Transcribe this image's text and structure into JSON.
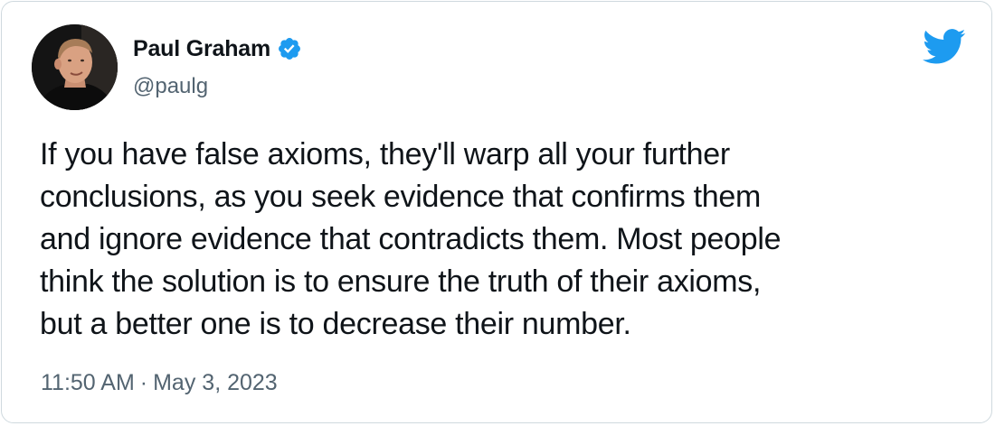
{
  "tweet": {
    "author_name": "Paul Graham",
    "author_handle": "@paulg",
    "text": "If you have false axioms, they'll warp all your further\nconclusions, as you seek evidence that confirms them\nand ignore evidence that contradicts them. Most people\nthink the solution is to ensure the truth of their axioms,\nbut a better one is to decrease their number.",
    "time": "11:50 AM",
    "separator": "·",
    "date": "May 3, 2023"
  },
  "icons": {
    "verified": "verified-badge-icon",
    "platform": "twitter-bird-icon",
    "avatar": "profile-photo"
  },
  "colors": {
    "accent": "#1d9bf0",
    "text": "#0f1419",
    "secondary": "#536471",
    "border": "#cfd9de"
  }
}
